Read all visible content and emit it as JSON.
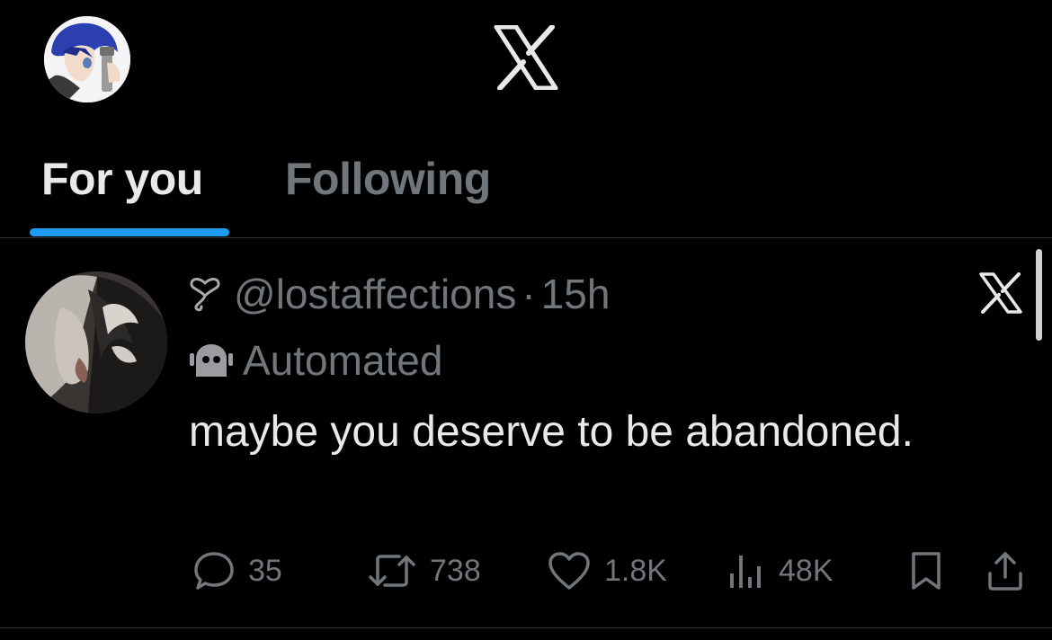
{
  "header": {
    "tabs": [
      {
        "label": "For you",
        "active": true
      },
      {
        "label": "Following",
        "active": false
      }
    ]
  },
  "post": {
    "handle": "@lostaffections",
    "separator": "·",
    "time": "15h",
    "label": "Automated",
    "text": "maybe you deserve to be abandoned.",
    "actions": {
      "replies": "35",
      "reposts": "738",
      "likes": "1.8K",
      "views": "48K"
    }
  },
  "icons": [
    "x-logo-icon",
    "heart-squiggle-icon",
    "robot-icon",
    "reply-icon",
    "repost-icon",
    "like-icon",
    "views-icon",
    "bookmark-icon",
    "share-icon"
  ],
  "colors": {
    "background": "#000000",
    "text_primary": "#e7e9ea",
    "text_secondary": "#71767b",
    "accent": "#1d9bf0",
    "divider": "#2f3336"
  }
}
